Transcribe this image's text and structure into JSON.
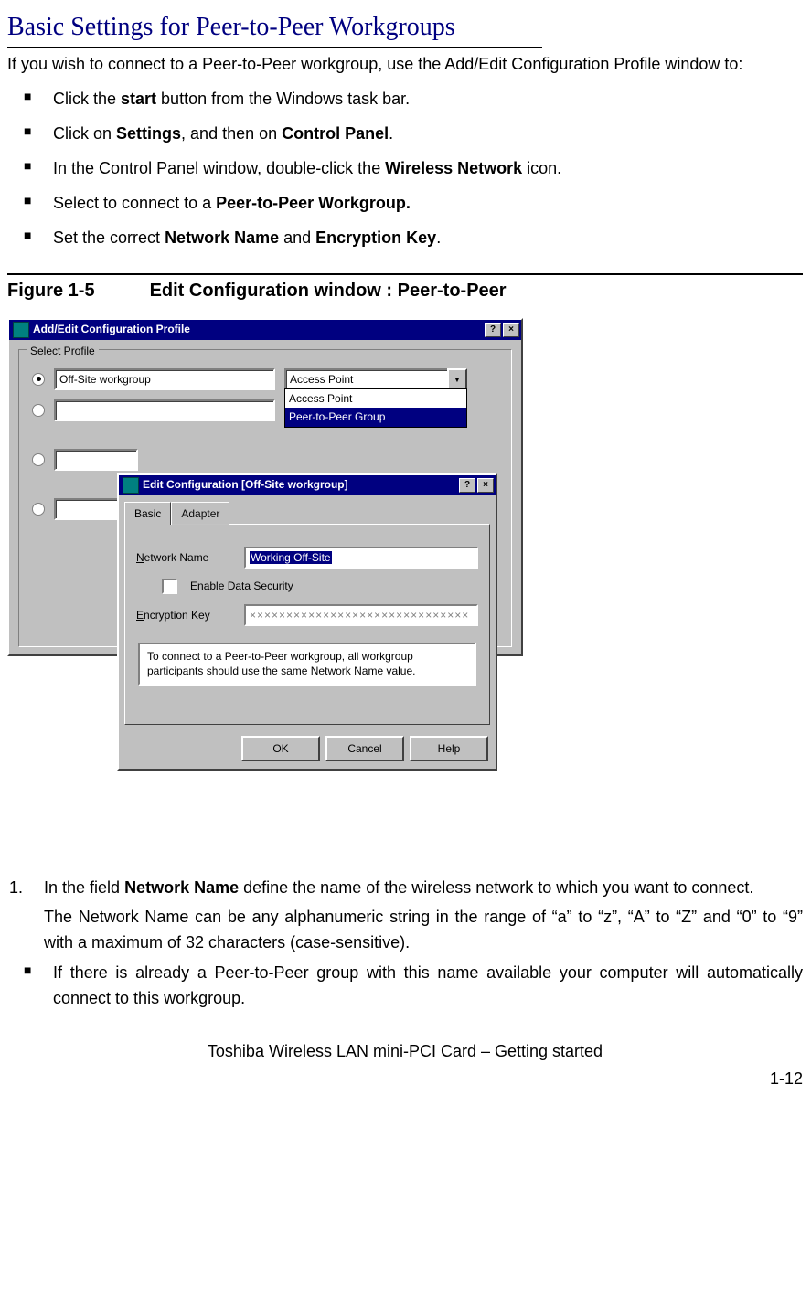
{
  "title": "Basic Settings for Peer-to-Peer Workgroups",
  "intro": "If you wish to connect to a Peer-to-Peer workgroup, use the Add/Edit Configuration Profile window to:",
  "bullets": [
    {
      "pre": "Click the ",
      "bold": "start",
      "post": " button from the Windows task bar."
    },
    {
      "pre": "Click on ",
      "bold": "Settings",
      "mid": ", and then on ",
      "bold2": "Control Panel",
      "post": "."
    },
    {
      "pre": "In the Control Panel window, double-click the ",
      "bold": "Wireless Network",
      "post": " icon."
    },
    {
      "pre": "Select to connect to a ",
      "bold": "Peer-to-Peer Workgroup.",
      "post": ""
    },
    {
      "pre": "Set the correct ",
      "bold": "Network Name",
      "mid": " and ",
      "bold2": "Encryption Key",
      "post": "."
    }
  ],
  "figure": {
    "label": "Figure 1-5",
    "caption": "Edit Configuration window : Peer-to-Peer"
  },
  "win1": {
    "title": "Add/Edit Configuration Profile",
    "group": "Select Profile",
    "profile_value": "Off-Site workgroup",
    "dd_selected": "Access Point",
    "dd_options": [
      "Access Point",
      "Peer-to-Peer Group"
    ]
  },
  "win2": {
    "title": "Edit Configuration [Off-Site workgroup]",
    "tabs": [
      "Basic",
      "Adapter"
    ],
    "net_label_u": "N",
    "net_label_rest": "etwork Name",
    "net_value": "Working Off-Site",
    "enable_u": "E",
    "enable_rest": "nable Data Security",
    "enc_label": "Encryption Key",
    "enc_value": "××××××××××××××××××××××××××××××",
    "msg": "To connect to a Peer-to-Peer workgroup, all workgroup participants should use the same Network Name value.",
    "ok": "OK",
    "cancel": "Cancel",
    "help": "Help"
  },
  "step1": {
    "pre": "In the field ",
    "bold": "Network Name",
    "post": " define the name of the wireless network to which you want to connect.",
    "line2": "The Network Name can be any alphanumeric string in the range of  “a” to “z”, “A” to “Z” and “0” to “9” with a maximum of 32 characters (case-sensitive)."
  },
  "bullet_last": "If there is already a Peer-to-Peer group with this name available your computer will automatically connect to this workgroup.",
  "footer": "Toshiba Wireless LAN mini-PCI Card – Getting started",
  "page": "1-12"
}
